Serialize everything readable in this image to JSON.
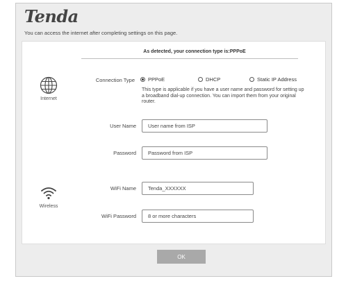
{
  "header": {
    "logo_text": "Tenda",
    "subtitle": "You can access the internet after completing settings on this page."
  },
  "detection": {
    "message": "As detected, your connection type is:PPPoE"
  },
  "internet_section": {
    "icon": "globe-icon",
    "label": "Internet",
    "connection_type_label": "Connection Type",
    "options": [
      {
        "label": "PPPoE",
        "selected": true
      },
      {
        "label": "DHCP",
        "selected": false
      },
      {
        "label": "Static IP Address",
        "selected": false
      }
    ],
    "description": "This type is applicable if you have a user name and password for setting up a broadband dial-up connection. You can import them from your original router.",
    "username": {
      "label": "User Name",
      "placeholder": "User name from ISP",
      "value": ""
    },
    "password": {
      "label": "Password",
      "placeholder": "Password from ISP",
      "value": ""
    }
  },
  "wireless_section": {
    "icon": "wifi-icon",
    "label": "Wireless",
    "wifi_name": {
      "label": "WiFi Name",
      "value": "Tenda_XXXXXX"
    },
    "wifi_password": {
      "label": "WiFi Password",
      "placeholder": "8 or more characters",
      "value": ""
    }
  },
  "footer": {
    "ok_label": "OK"
  }
}
